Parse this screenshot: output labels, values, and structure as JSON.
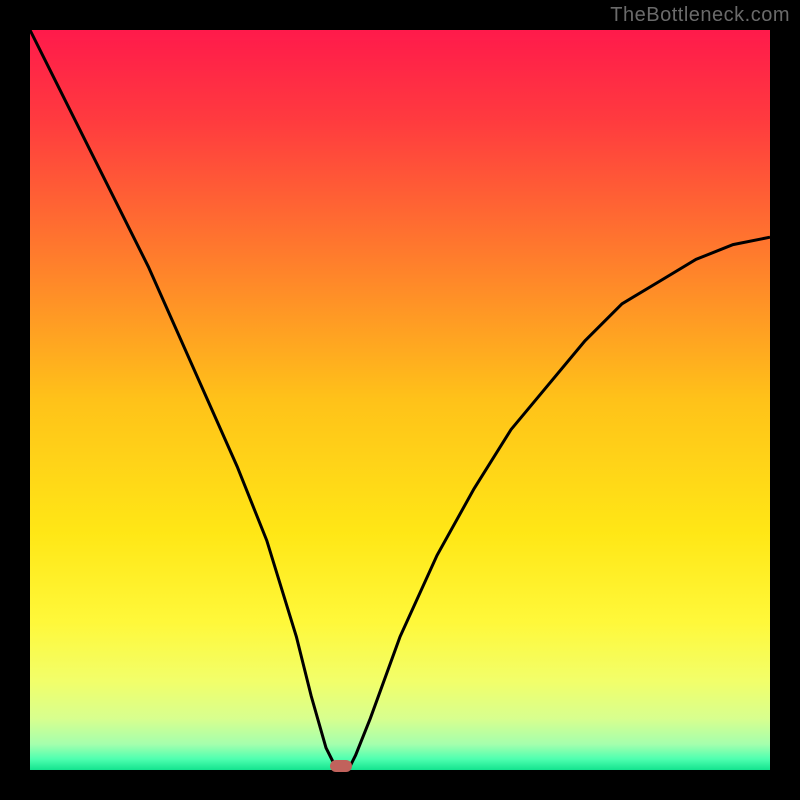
{
  "watermark": {
    "text": "TheBottleneck.com"
  },
  "colors": {
    "frame": "#000000",
    "curve_stroke": "#000000",
    "marker_fill": "#c1625c",
    "gradient_stops": [
      {
        "pos": 0.0,
        "color": "#ff1a4b"
      },
      {
        "pos": 0.12,
        "color": "#ff3a3f"
      },
      {
        "pos": 0.3,
        "color": "#ff7a2d"
      },
      {
        "pos": 0.5,
        "color": "#ffc219"
      },
      {
        "pos": 0.68,
        "color": "#ffe716"
      },
      {
        "pos": 0.8,
        "color": "#fff83a"
      },
      {
        "pos": 0.88,
        "color": "#f2ff6a"
      },
      {
        "pos": 0.93,
        "color": "#d8ff8e"
      },
      {
        "pos": 0.965,
        "color": "#a5ffad"
      },
      {
        "pos": 0.985,
        "color": "#4fffb0"
      },
      {
        "pos": 1.0,
        "color": "#14e38e"
      }
    ]
  },
  "chart_data": {
    "type": "line",
    "title": "",
    "xlabel": "",
    "ylabel": "",
    "xlim": [
      0,
      100
    ],
    "ylim": [
      0,
      100
    ],
    "grid": false,
    "legend": false,
    "series": [
      {
        "name": "bottleneck-curve",
        "x": [
          0,
          4,
          8,
          12,
          16,
          20,
          24,
          28,
          32,
          36,
          38,
          40,
          41,
          42,
          43,
          44,
          46,
          50,
          55,
          60,
          65,
          70,
          75,
          80,
          85,
          90,
          95,
          100
        ],
        "y": [
          100,
          92,
          84,
          76,
          68,
          59,
          50,
          41,
          31,
          18,
          10,
          3,
          1,
          0,
          0,
          2,
          7,
          18,
          29,
          38,
          46,
          52,
          58,
          63,
          66,
          69,
          71,
          72
        ]
      }
    ],
    "flat_bottom": {
      "x_start": 41,
      "x_end": 43,
      "y": 0
    },
    "marker": {
      "x": 42,
      "y": 0
    },
    "annotations": []
  }
}
